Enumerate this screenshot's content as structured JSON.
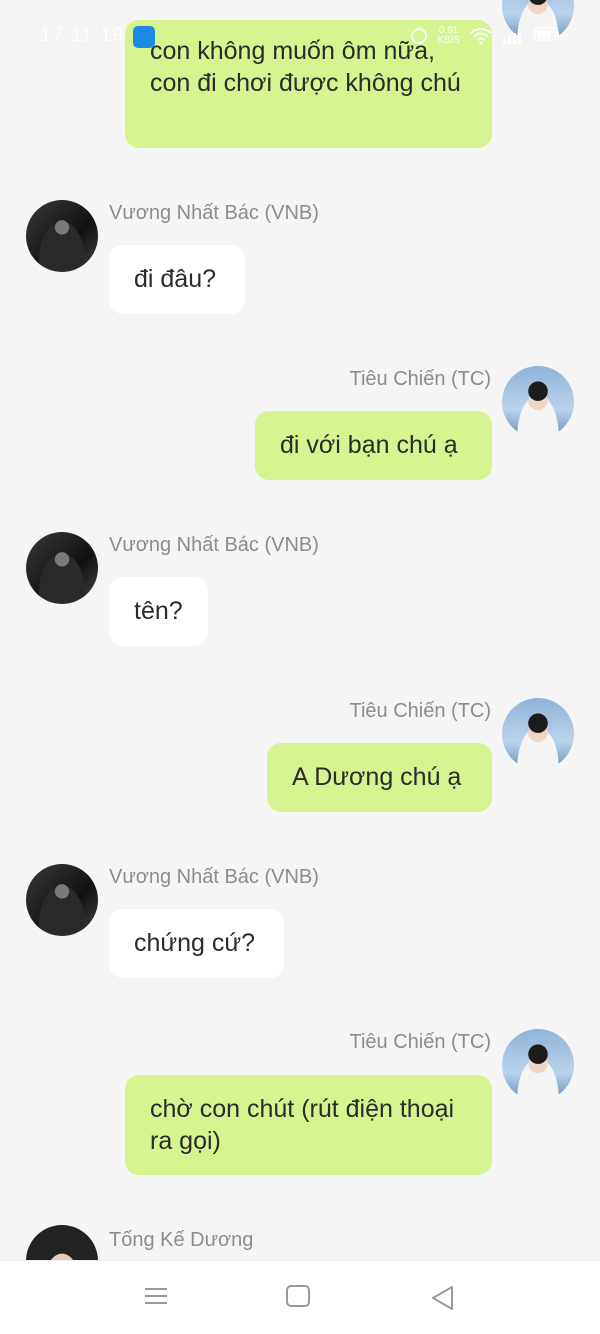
{
  "status_bar": {
    "time": "17:11:19",
    "net_speed": "0.91",
    "net_unit": "KB/S"
  },
  "colors": {
    "background": "#f5f5f5",
    "bubble_self": "#d6f48f",
    "bubble_other": "#ffffff",
    "sender_name": "#8c8c8c"
  },
  "messages": [
    {
      "id": "m0",
      "side": "right",
      "sender": "",
      "text": "con không muốn ôm nữa, con đi chơi được không chú"
    },
    {
      "id": "m1",
      "side": "left",
      "sender": "Vương Nhất Bác (VNB)",
      "text": "đi đâu?"
    },
    {
      "id": "m2",
      "side": "right",
      "sender": "Tiêu Chiến (TC)",
      "text": "đi với bạn chú ạ"
    },
    {
      "id": "m3",
      "side": "left",
      "sender": "Vương Nhất Bác (VNB)",
      "text": "tên?"
    },
    {
      "id": "m4",
      "side": "right",
      "sender": "Tiêu Chiến (TC)",
      "text": "A Dương chú ạ"
    },
    {
      "id": "m5",
      "side": "left",
      "sender": "Vương Nhất Bác (VNB)",
      "text": "chứng cứ?"
    },
    {
      "id": "m6",
      "side": "right",
      "sender": "Tiêu Chiến (TC)",
      "text": "chờ con chút (rút điện thoại ra gọi)"
    },
    {
      "id": "m7",
      "side": "left",
      "sender": "Tống Kế Dương",
      "text": ""
    }
  ],
  "nav": {
    "menu_icon": "menu-icon",
    "home_icon": "home-icon",
    "back_icon": "back-icon"
  }
}
